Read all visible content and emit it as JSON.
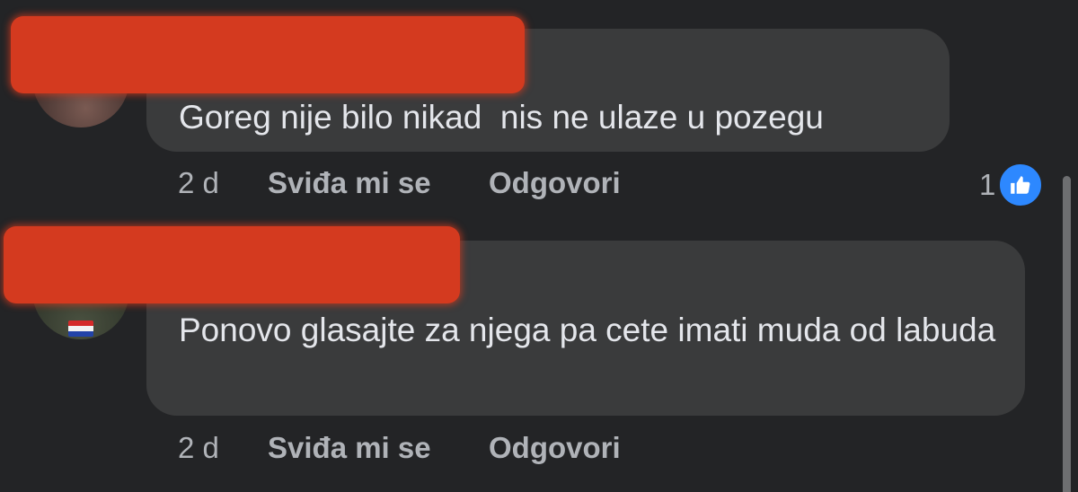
{
  "comments": [
    {
      "text": "Goreg nije bilo nikad  nis ne ulaze u pozegu",
      "time": "2 d",
      "like_label": "Sviđa mi se",
      "reply_label": "Odgovori",
      "reactions": {
        "count": "1",
        "icon": "thumbs-up-icon",
        "color": "#2d88ff"
      }
    },
    {
      "text": "Ponovo glasajte za njega pa cete imati muda od labuda",
      "time": "2 d",
      "like_label": "Sviđa mi se",
      "reply_label": "Odgovori"
    }
  ],
  "colors": {
    "background": "#232426",
    "bubble": "#3a3b3c",
    "text": "#e4e6eb",
    "secondary_text": "#b0b3b8",
    "redaction": "#d43a1f"
  }
}
